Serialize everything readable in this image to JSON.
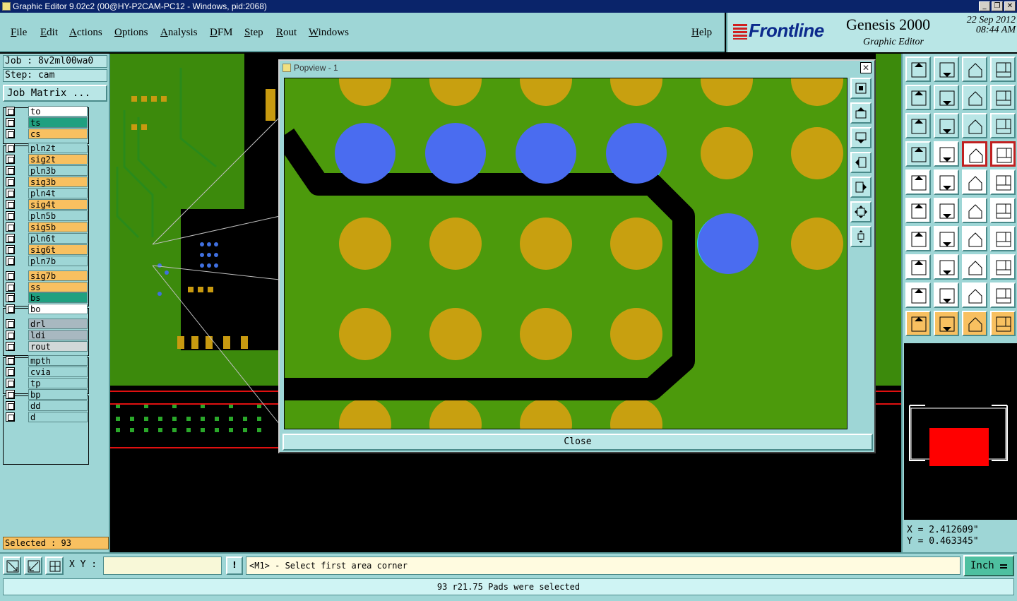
{
  "window": {
    "title": "Graphic Editor 9.02c2 (00@HY-P2CAM-PC12 - Windows, pid:2068)",
    "minimize": "_",
    "maximize": "❐",
    "close": "✕"
  },
  "menu": {
    "items": [
      "File",
      "Edit",
      "Actions",
      "Options",
      "Analysis",
      "DFM",
      "Step",
      "Rout",
      "Windows"
    ],
    "help": "Help"
  },
  "brand": {
    "logo": "Frontline",
    "product": "Genesis 2000",
    "subtitle": "Graphic Editor",
    "date": "22 Sep 2012",
    "time": "08:44 AM"
  },
  "job": {
    "job_label": "Job : 8v2ml00wa0",
    "step_label": "Step: cam",
    "matrix_button": "Job Matrix ..."
  },
  "layers": [
    {
      "name": "to",
      "color": "#ffffff"
    },
    {
      "name": "ts",
      "color": "#20a080"
    },
    {
      "name": "cs",
      "color": "#f8c060"
    },
    {
      "name": "pln2t",
      "color": "#9ed6d6"
    },
    {
      "name": "sig2t",
      "color": "#f8c060"
    },
    {
      "name": "pln3b",
      "color": "#9ed6d6"
    },
    {
      "name": "sig3b",
      "color": "#f8c060"
    },
    {
      "name": "pln4t",
      "color": "#9ed6d6"
    },
    {
      "name": "sig4t",
      "color": "#f8c060"
    },
    {
      "name": "pln5b",
      "color": "#9ed6d6"
    },
    {
      "name": "sig5b",
      "color": "#f8c060"
    },
    {
      "name": "pln6t",
      "color": "#9ed6d6"
    },
    {
      "name": "sig6t",
      "color": "#f8c060"
    },
    {
      "name": "pln7b",
      "color": "#9ed6d6"
    },
    {
      "name": "sig7b",
      "color": "#f8c060"
    },
    {
      "name": "ss",
      "color": "#f8c060"
    },
    {
      "name": "bs",
      "color": "#20a080"
    },
    {
      "name": "bo",
      "color": "#ffffff"
    },
    {
      "name": "drl",
      "color": "#a8b8c0"
    },
    {
      "name": "ldi",
      "color": "#a8b8c0"
    },
    {
      "name": "rout",
      "color": "#d0d8d8"
    },
    {
      "name": "mpth",
      "color": "#9ed6d6"
    },
    {
      "name": "cvia",
      "color": "#9ed6d6"
    },
    {
      "name": "tp",
      "color": "#9ed6d6"
    },
    {
      "name": "bp",
      "color": "#9ed6d6"
    },
    {
      "name": "dd",
      "color": "#9ed6d6"
    },
    {
      "name": "d",
      "color": "#9ed6d6"
    }
  ],
  "selected_status": "Selected : 93",
  "popview": {
    "title": "Popview - 1",
    "close_x": "✕",
    "close_button": "Close"
  },
  "coords": {
    "x": "X = 2.412609\"",
    "y": "Y = 0.463345\""
  },
  "bottom": {
    "xy_label": "X Y :",
    "xy_value": "",
    "warn": "!",
    "prompt": "<M1> - Select first area corner",
    "unit": "Inch"
  },
  "status_message": "93 r21.75 Pads were selected",
  "colors": {
    "panel": "#9ed6d6",
    "board_green": "#4c9a0c",
    "pad_gold": "#c8a010",
    "pad_selected": "#4a6cf0",
    "trace": "#000000",
    "highlight_red": "#e00000"
  }
}
